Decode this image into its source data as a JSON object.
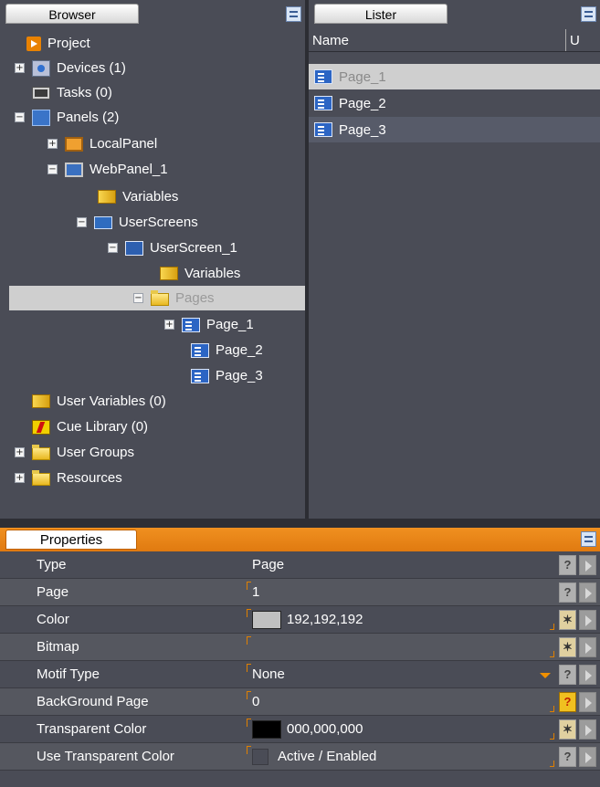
{
  "browser": {
    "title": "Browser",
    "tree": [
      {
        "label": "Project",
        "icon": "project-icon",
        "expander": "",
        "depth": 0
      },
      {
        "label": "Devices (1)",
        "icon": "devices-icon",
        "expander": "+",
        "depth": 0
      },
      {
        "label": "Tasks (0)",
        "icon": "tasks-icon",
        "expander": "",
        "depth": 0
      },
      {
        "label": "Panels (2)",
        "icon": "panels-icon",
        "expander": "−",
        "depth": 0
      },
      {
        "label": "LocalPanel",
        "icon": "local-panel-icon",
        "expander": "+",
        "depth": 1
      },
      {
        "label": "WebPanel_1",
        "icon": "web-panel-icon",
        "expander": "−",
        "depth": 1
      },
      {
        "label": "Variables",
        "icon": "variables-icon",
        "expander": "",
        "depth": 2
      },
      {
        "label": "UserScreens",
        "icon": "user-screens-icon",
        "expander": "−",
        "depth": 2
      },
      {
        "label": "UserScreen_1",
        "icon": "user-screen-icon",
        "expander": "−",
        "depth": 3
      },
      {
        "label": "Variables",
        "icon": "variables-icon",
        "expander": "",
        "depth": 4
      },
      {
        "label": "Pages",
        "icon": "folder-icon",
        "expander": "−",
        "depth": 4
      },
      {
        "label": "Page_1",
        "icon": "page-icon",
        "expander": "+",
        "depth": 5
      },
      {
        "label": "Page_2",
        "icon": "page-icon",
        "expander": "",
        "depth": 5
      },
      {
        "label": "Page_3",
        "icon": "page-icon",
        "expander": "",
        "depth": 5
      },
      {
        "label": "User Variables (0)",
        "icon": "variables-icon",
        "expander": "",
        "depth": 0
      },
      {
        "label": "Cue Library (0)",
        "icon": "cue-library-icon",
        "expander": "",
        "depth": 0
      },
      {
        "label": "User Groups",
        "icon": "folder-icon",
        "expander": "+",
        "depth": 0
      },
      {
        "label": "Resources",
        "icon": "folder-icon",
        "expander": "+",
        "depth": 0
      }
    ]
  },
  "lister": {
    "title": "Lister",
    "columns": [
      "Name",
      "U"
    ],
    "rows": [
      "Page_1",
      "Page_2",
      "Page_3"
    ]
  },
  "properties": {
    "title": "Properties",
    "rows": [
      {
        "name": "Type",
        "value": "Page"
      },
      {
        "name": "Page",
        "value": "1"
      },
      {
        "name": "Color",
        "value": "192,192,192",
        "swatch": "#c0c0c0"
      },
      {
        "name": "Bitmap",
        "value": ""
      },
      {
        "name": "Motif Type",
        "value": "None"
      },
      {
        "name": "BackGround Page",
        "value": "0"
      },
      {
        "name": "Transparent Color",
        "value": "000,000,000",
        "swatch": "#000000"
      },
      {
        "name": "Use Transparent Color",
        "value": "Active / Enabled"
      }
    ]
  },
  "colors": {
    "accent": "#e98200",
    "pane_bg": "#4a4c56",
    "selection": "#cfcfcf"
  }
}
